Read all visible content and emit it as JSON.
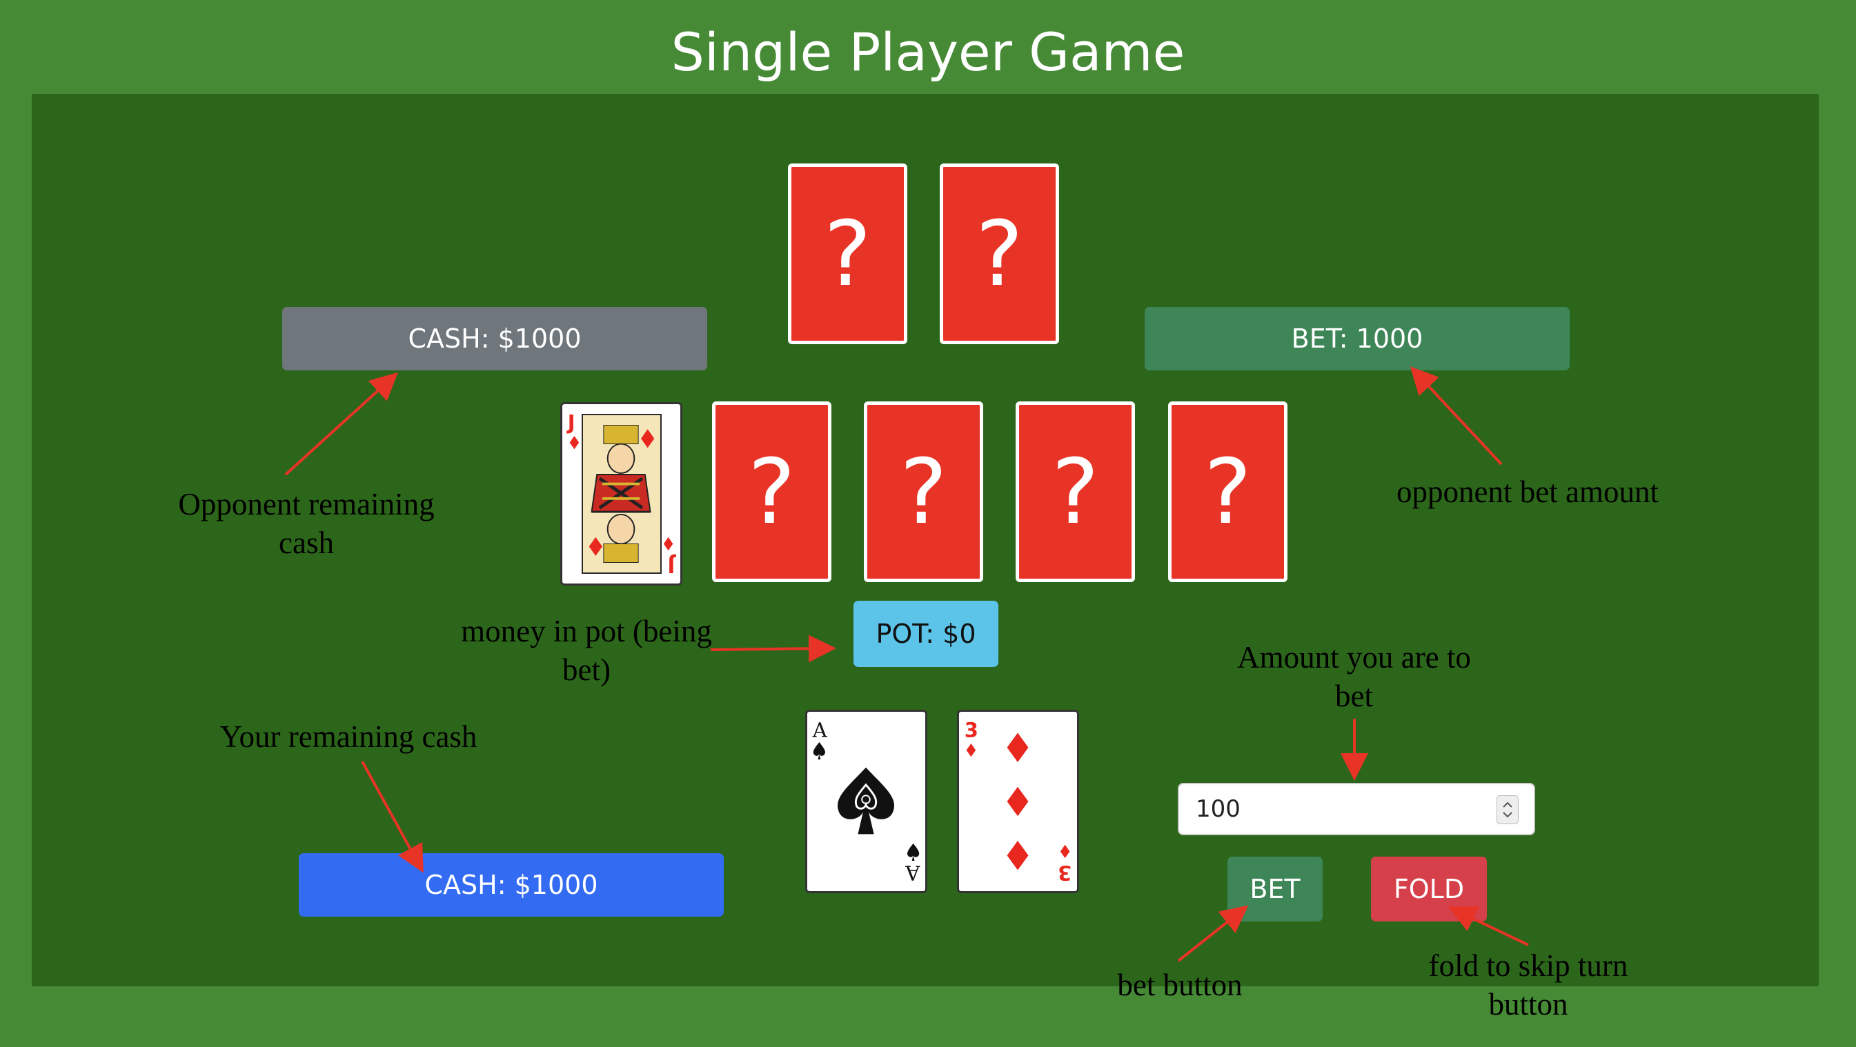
{
  "title": "Single Player Game",
  "opponent": {
    "cash_label": "CASH: $1000",
    "bet_label": "BET: 1000",
    "hand": [
      "?",
      "?"
    ]
  },
  "community": {
    "revealed": {
      "rank": "J",
      "suit": "diamonds"
    },
    "hidden": [
      "?",
      "?",
      "?",
      "?"
    ]
  },
  "pot_label": "POT: $0",
  "player": {
    "cash_label": "CASH: $1000",
    "hand": [
      {
        "rank": "A",
        "suit": "spades"
      },
      {
        "rank": "3",
        "suit": "diamonds"
      }
    ]
  },
  "controls": {
    "bet_amount": "100",
    "bet_button": "BET",
    "fold_button": "FOLD"
  },
  "annotations": {
    "opp_cash": "Opponent remaining cash",
    "opp_bet": "opponent bet amount",
    "pot": "money in pot (being bet)",
    "your_cash": "Your remaining cash",
    "amount": "Amount you are to bet",
    "bet_btn": "bet button",
    "fold_btn": "fold to skip turn button"
  },
  "colors": {
    "background": "#468a35",
    "table": "#2c661a",
    "card_back": "#e83426",
    "opp_cash": "#6f767c",
    "opp_bet": "#3e8657",
    "pot": "#5bc4e8",
    "player_cash": "#336cf2",
    "bet_button": "#3e8657",
    "fold_button": "#d5404a",
    "arrow": "#e83426",
    "suit_red": "#e8271f"
  }
}
